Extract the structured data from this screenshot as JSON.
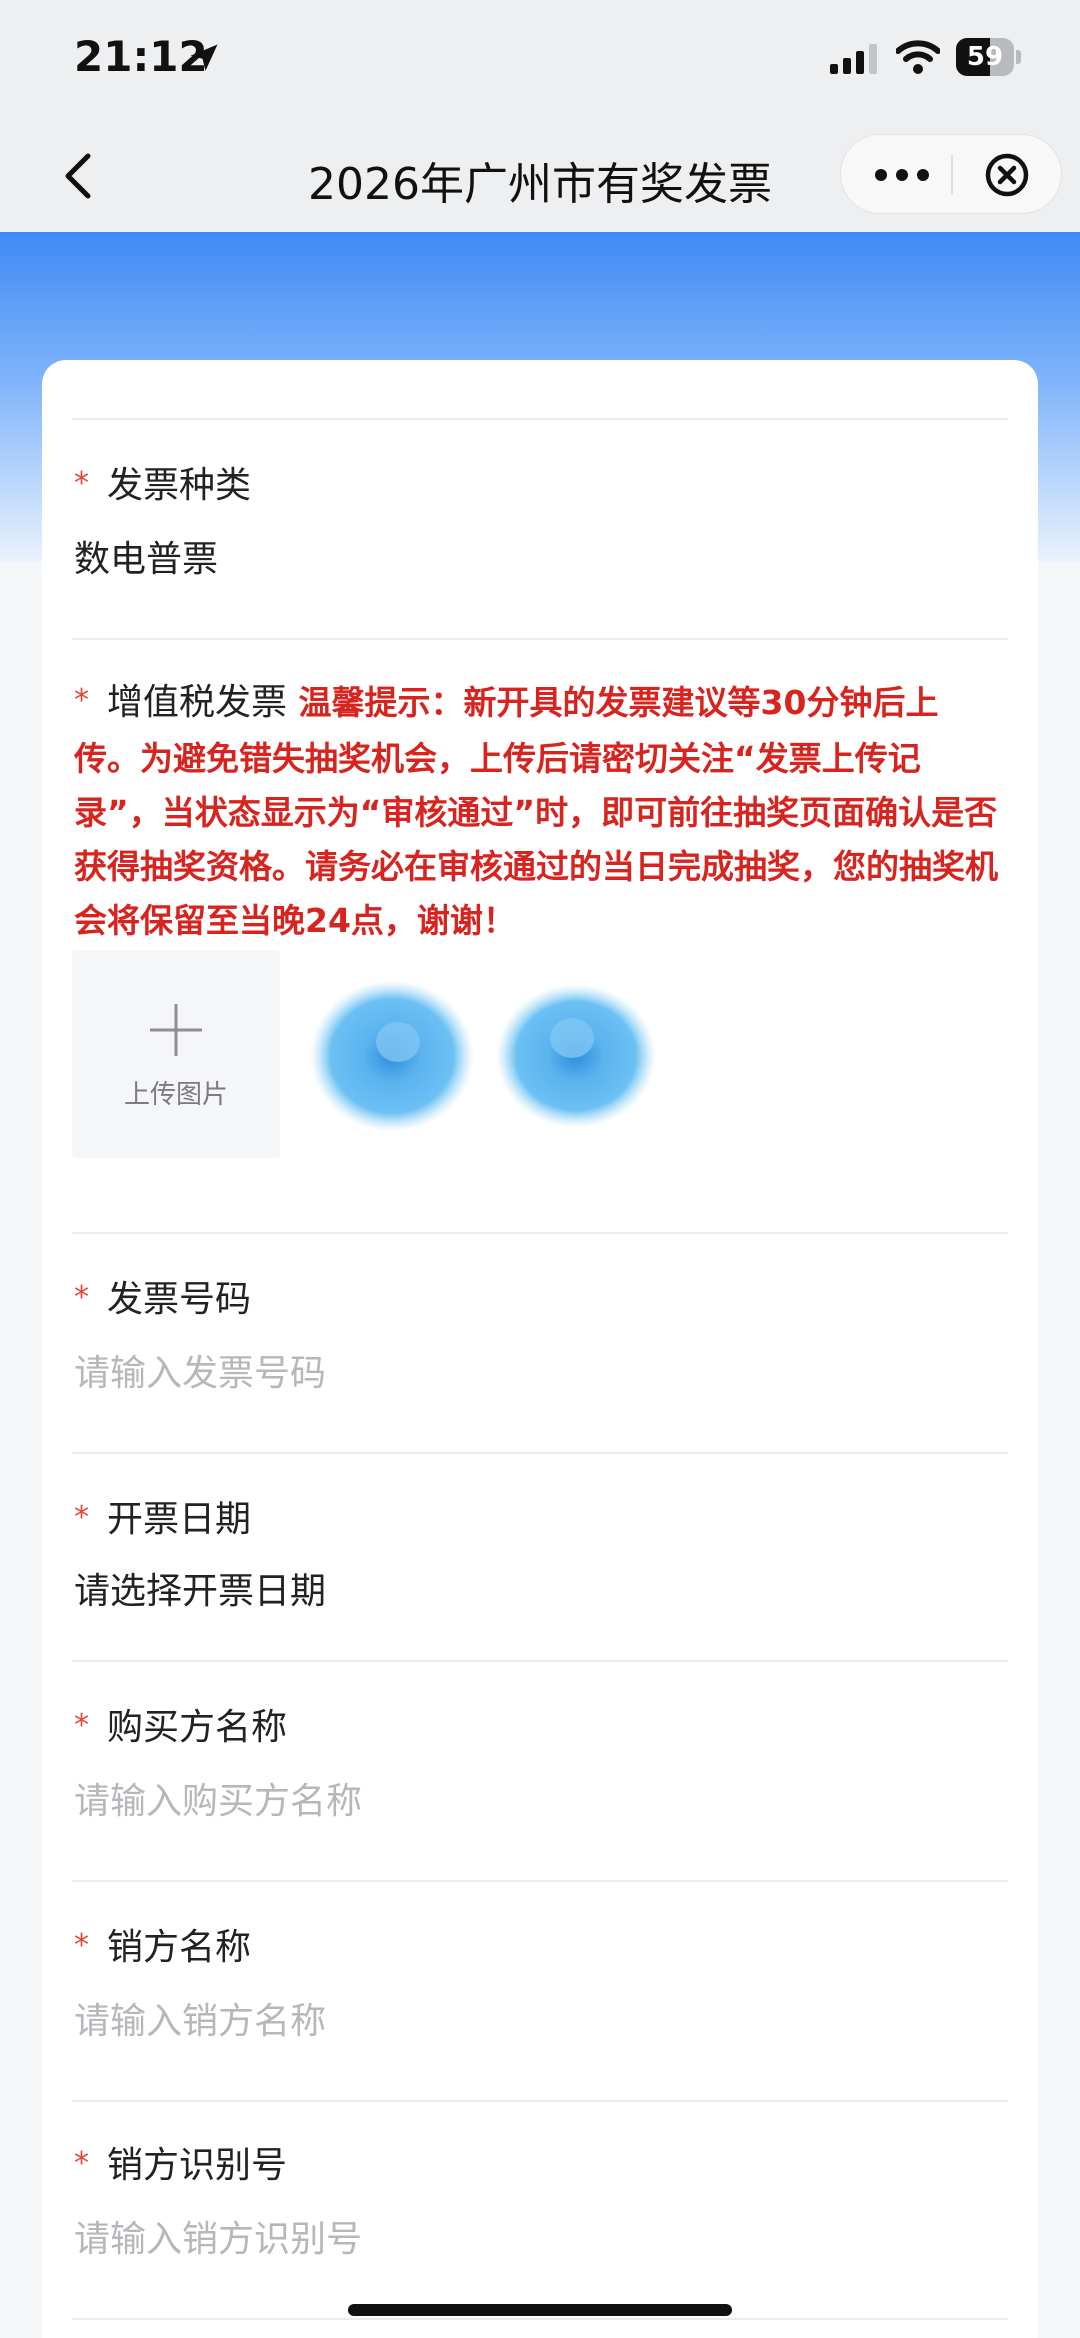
{
  "status_bar": {
    "time": "21:12",
    "battery_level": "59"
  },
  "nav": {
    "title": "2026年广州市有奖发票"
  },
  "form": {
    "invoice_type": {
      "label": "发票种类",
      "value": "数电普票"
    },
    "vat_invoice": {
      "label": "增值税发票",
      "hint": "温馨提示：新开具的发票建议等30分钟后上传。为避免错失抽奖机会，上传后请密切关注“发票上传记录”，当状态显示为“审核通过”时，即可前往抽奖页面确认是否获得抽奖资格。请务必在审核通过的当日完成抽奖，您的抽奖机会将保留至当晚24点，谢谢！",
      "upload_label": "上传图片"
    },
    "invoice_number": {
      "label": "发票号码",
      "placeholder": "请输入发票号码"
    },
    "invoice_date": {
      "label": "开票日期",
      "value": "请选择开票日期"
    },
    "buyer_name": {
      "label": "购买方名称",
      "placeholder": "请输入购买方名称"
    },
    "seller_name": {
      "label": "销方名称",
      "placeholder": "请输入销方名称"
    },
    "seller_id": {
      "label": "销方识别号",
      "placeholder": "请输入销方识别号"
    }
  },
  "required_mark": "*",
  "colors": {
    "accent_blue": "#3f8af5",
    "required_red": "#e2463b",
    "hint_red": "#d8241f",
    "placeholder_gray": "#b7b7bb"
  },
  "icons": [
    "location-arrow-icon",
    "signal-icon",
    "wifi-icon",
    "battery-icon",
    "back-icon",
    "more-icon",
    "close-icon",
    "plus-icon"
  ]
}
